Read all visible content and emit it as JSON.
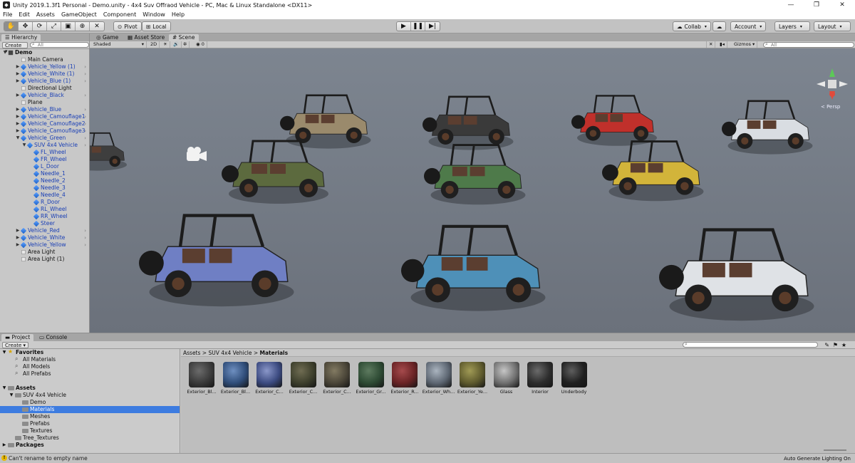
{
  "window": {
    "title": "Unity 2019.1.3f1 Personal - Demo.unity - 4x4 Suv Offraod Vehicle - PC, Mac & Linux Standalone <DX11>",
    "controls": [
      "—",
      "❐",
      "✕"
    ]
  },
  "menu": [
    "File",
    "Edit",
    "Assets",
    "GameObject",
    "Component",
    "Window",
    "Help"
  ],
  "toolbar": {
    "pivot": "Pivot",
    "local": "Local",
    "collab": "Collab",
    "account": "Account",
    "layers": "Layers",
    "layout": "Layout"
  },
  "hierarchy": {
    "tab": "Hierarchy",
    "create": "Create",
    "search": "All",
    "scene": "Demo",
    "items": [
      {
        "label": "Main Camera",
        "depth": 1,
        "prefab": false,
        "expand": "",
        "more": false
      },
      {
        "label": "Vehicle_Yellow (1)",
        "depth": 1,
        "prefab": true,
        "expand": "▶",
        "more": true
      },
      {
        "label": "Vehicle_White (1)",
        "depth": 1,
        "prefab": true,
        "expand": "▶",
        "more": true
      },
      {
        "label": "Vehicle_Blue (1)",
        "depth": 1,
        "prefab": true,
        "expand": "▶",
        "more": true
      },
      {
        "label": "Directional Light",
        "depth": 1,
        "prefab": false,
        "expand": "",
        "more": false
      },
      {
        "label": "Vehicle_Black",
        "depth": 1,
        "prefab": true,
        "expand": "▶",
        "more": true
      },
      {
        "label": "Plane",
        "depth": 1,
        "prefab": false,
        "expand": "",
        "more": false
      },
      {
        "label": "Vehicle_Blue",
        "depth": 1,
        "prefab": true,
        "expand": "▶",
        "more": true
      },
      {
        "label": "Vehicle_Camouflage1",
        "depth": 1,
        "prefab": true,
        "expand": "▶",
        "more": true
      },
      {
        "label": "Vehicle_Camouflage2",
        "depth": 1,
        "prefab": true,
        "expand": "▶",
        "more": true
      },
      {
        "label": "Vehicle_Camouflage3",
        "depth": 1,
        "prefab": true,
        "expand": "▶",
        "more": true
      },
      {
        "label": "Vehicle_Green",
        "depth": 1,
        "prefab": true,
        "expand": "▼",
        "more": true
      },
      {
        "label": "SUV 4x4 Vehicle",
        "depth": 2,
        "prefab": true,
        "expand": "▼",
        "more": true
      },
      {
        "label": "FL_Wheel",
        "depth": 3,
        "prefab": true,
        "expand": "",
        "more": false
      },
      {
        "label": "FR_Wheel",
        "depth": 3,
        "prefab": true,
        "expand": "",
        "more": false
      },
      {
        "label": "L_Door",
        "depth": 3,
        "prefab": true,
        "expand": "",
        "more": false
      },
      {
        "label": "Needle_1",
        "depth": 3,
        "prefab": true,
        "expand": "",
        "more": false
      },
      {
        "label": "Needle_2",
        "depth": 3,
        "prefab": true,
        "expand": "",
        "more": false
      },
      {
        "label": "Needle_3",
        "depth": 3,
        "prefab": true,
        "expand": "",
        "more": false
      },
      {
        "label": "Needle_4",
        "depth": 3,
        "prefab": true,
        "expand": "",
        "more": false
      },
      {
        "label": "R_Door",
        "depth": 3,
        "prefab": true,
        "expand": "",
        "more": false
      },
      {
        "label": "RL_Wheel",
        "depth": 3,
        "prefab": true,
        "expand": "",
        "more": false
      },
      {
        "label": "RR_Wheel",
        "depth": 3,
        "prefab": true,
        "expand": "",
        "more": false
      },
      {
        "label": "Steer",
        "depth": 3,
        "prefab": true,
        "expand": "",
        "more": false
      },
      {
        "label": "Vehicle_Red",
        "depth": 1,
        "prefab": true,
        "expand": "▶",
        "more": true
      },
      {
        "label": "Vehicle_White",
        "depth": 1,
        "prefab": true,
        "expand": "▶",
        "more": true
      },
      {
        "label": "Vehicle_Yellow",
        "depth": 1,
        "prefab": true,
        "expand": "▶",
        "more": true
      },
      {
        "label": "Area Light",
        "depth": 1,
        "prefab": false,
        "expand": "",
        "more": false
      },
      {
        "label": "Area Light (1)",
        "depth": 1,
        "prefab": false,
        "expand": "",
        "more": false
      }
    ]
  },
  "sceneTabs": {
    "game": "Game",
    "assetStore": "Asset Store",
    "scene": "Scene"
  },
  "sceneToolbar": {
    "shading": "Shaded",
    "mode2d": "2D",
    "hiddenCount": "0",
    "gizmos": "Gizmos",
    "search": "All",
    "persp": "< Persp"
  },
  "project": {
    "tabs": [
      "Project",
      "Console"
    ],
    "create": "Create",
    "breadcrumb": [
      "Assets",
      "SUV 4x4 Vehicle",
      "Materials"
    ],
    "tree": [
      {
        "label": "Favorites",
        "depth": 0,
        "kind": "star",
        "expand": "▼",
        "bold": true,
        "selected": false
      },
      {
        "label": "All Materials",
        "depth": 1,
        "kind": "search",
        "expand": "",
        "bold": false,
        "selected": false
      },
      {
        "label": "All Models",
        "depth": 1,
        "kind": "search",
        "expand": "",
        "bold": false,
        "selected": false
      },
      {
        "label": "All Prefabs",
        "depth": 1,
        "kind": "search",
        "expand": "",
        "bold": false,
        "selected": false
      },
      {
        "label": "",
        "depth": 0,
        "kind": "spacer",
        "expand": "",
        "bold": false,
        "selected": false
      },
      {
        "label": "Assets",
        "depth": 0,
        "kind": "folder",
        "expand": "▼",
        "bold": true,
        "selected": false
      },
      {
        "label": "SUV 4x4 Vehicle",
        "depth": 1,
        "kind": "folder",
        "expand": "▼",
        "bold": false,
        "selected": false
      },
      {
        "label": "Demo",
        "depth": 2,
        "kind": "folder",
        "expand": "",
        "bold": false,
        "selected": false
      },
      {
        "label": "Materials",
        "depth": 2,
        "kind": "folder",
        "expand": "",
        "bold": false,
        "selected": true
      },
      {
        "label": "Meshes",
        "depth": 2,
        "kind": "folder",
        "expand": "",
        "bold": false,
        "selected": false
      },
      {
        "label": "Prefabs",
        "depth": 2,
        "kind": "folder",
        "expand": "",
        "bold": false,
        "selected": false
      },
      {
        "label": "Textures",
        "depth": 2,
        "kind": "folder",
        "expand": "",
        "bold": false,
        "selected": false
      },
      {
        "label": "Tree_Textures",
        "depth": 1,
        "kind": "folder",
        "expand": "",
        "bold": false,
        "selected": false
      },
      {
        "label": "Packages",
        "depth": 0,
        "kind": "folder",
        "expand": "▶",
        "bold": true,
        "selected": false
      }
    ],
    "materials": [
      {
        "name": "Exterior_Bl...",
        "c1": "#3a3a3a",
        "c2": "#6b6b6b"
      },
      {
        "name": "Exterior_Bl...",
        "c1": "#2f4d79",
        "c2": "#6e8fc0"
      },
      {
        "name": "Exterior_C...",
        "c1": "#3b4a80",
        "c2": "#8a97c9"
      },
      {
        "name": "Exterior_C...",
        "c1": "#3d3f2c",
        "c2": "#6f6c52"
      },
      {
        "name": "Exterior_C...",
        "c1": "#4a4538",
        "c2": "#827a62"
      },
      {
        "name": "Exterior_Gr...",
        "c1": "#2d4a33",
        "c2": "#5d7a5f"
      },
      {
        "name": "Exterior_R...",
        "c1": "#6a2325",
        "c2": "#a54a4c"
      },
      {
        "name": "Exterior_Wh...",
        "c1": "#5d6672",
        "c2": "#aab4bf"
      },
      {
        "name": "Exterior_Ye...",
        "c1": "#5e5a2d",
        "c2": "#a09a55"
      },
      {
        "name": "Glass",
        "c1": "#6f6f6f",
        "c2": "#c6c6c6"
      },
      {
        "name": "Interior",
        "c1": "#2c2c2c",
        "c2": "#6a6a6a"
      },
      {
        "name": "Underbody",
        "c1": "#1f1f1f",
        "c2": "#5e5e5e"
      }
    ]
  },
  "status": {
    "message": "Can't rename to empty name",
    "right": "Auto Generate Lighting On"
  },
  "vehicles": [
    {
      "name": "vehicle-black",
      "body": "#3e3e3e"
    },
    {
      "name": "vehicle-camouflage1",
      "body": "#9a8a6c"
    },
    {
      "name": "vehicle-black-2",
      "body": "#3a3a3a"
    },
    {
      "name": "vehicle-red",
      "body": "#c0302b"
    },
    {
      "name": "vehicle-white",
      "body": "#d9dde2"
    },
    {
      "name": "vehicle-camouflage2",
      "body": "#5c6a3e"
    },
    {
      "name": "vehicle-green",
      "body": "#4e7a4a"
    },
    {
      "name": "vehicle-yellow",
      "body": "#d2b43a"
    },
    {
      "name": "vehicle-camouflage3",
      "body": "#6f7fc4"
    },
    {
      "name": "vehicle-blue",
      "body": "#4e90b8"
    },
    {
      "name": "vehicle-white-2",
      "body": "#dfe2e6"
    }
  ]
}
